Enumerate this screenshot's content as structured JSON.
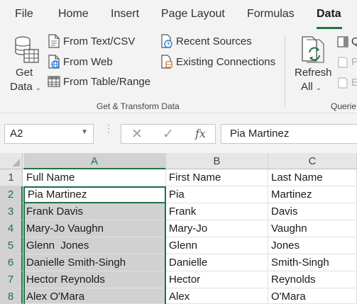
{
  "ribbon_tabs": [
    "File",
    "Home",
    "Insert",
    "Page Layout",
    "Formulas",
    "Data"
  ],
  "active_tab": "Data",
  "get_data": {
    "line1": "Get",
    "line2": "Data"
  },
  "commands": {
    "from_text_csv": "From Text/CSV",
    "from_web": "From Web",
    "from_table_range": "From Table/Range",
    "recent_sources": "Recent Sources",
    "existing_connections": "Existing Connections"
  },
  "group_label": "Get & Transform Data",
  "refresh": {
    "line1": "Refresh",
    "line2": "All"
  },
  "queries_group_label": "Querie",
  "clipped_items": [
    "Q",
    "P",
    "E"
  ],
  "name_box": "A2",
  "formula_bar": {
    "cancel_icon": "✕",
    "enter_icon": "✓",
    "fx": "fx",
    "content": "Pia Martinez"
  },
  "columns": [
    "A",
    "B",
    "C"
  ],
  "rows": [
    {
      "num": "1",
      "a": "Full Name",
      "b": "First Name",
      "c": "Last Name"
    },
    {
      "num": "2",
      "a": "Pia Martinez",
      "b": "Pia",
      "c": "Martinez"
    },
    {
      "num": "3",
      "a": "Frank Davis",
      "b": "Frank",
      "c": "Davis"
    },
    {
      "num": "4",
      "a": "Mary-Jo Vaughn",
      "b": "Mary-Jo",
      "c": "Vaughn"
    },
    {
      "num": "5",
      "a": "Glenn  Jones",
      "b": "Glenn",
      "c": "Jones"
    },
    {
      "num": "6",
      "a": "Danielle Smith-Singh",
      "b": "Danielle",
      "c": "Smith-Singh"
    },
    {
      "num": "7",
      "a": "Hector Reynolds",
      "b": "Hector",
      "c": "Reynolds"
    },
    {
      "num": "8",
      "a": "Alex O'Mara",
      "b": "Alex",
      "c": "O'Mara"
    }
  ],
  "colors": {
    "accent": "#217346",
    "ribbon_bg": "#f3f3f3",
    "selection": "#d1d1d1"
  }
}
